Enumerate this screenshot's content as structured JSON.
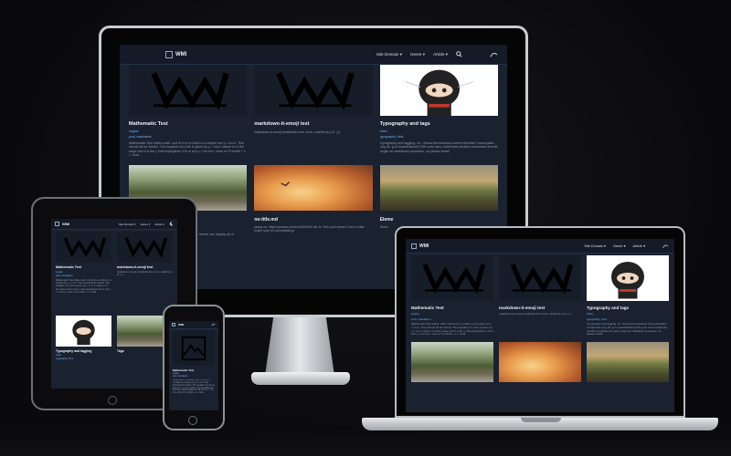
{
  "site": {
    "brand": "WMI",
    "nav": [
      "Site Domain ▾",
      "Genre ▾",
      "Article ▾"
    ],
    "search_icon": "search-icon",
    "theme_icon": "moon-icon"
  },
  "cards": [
    {
      "title": "Mathematic Test",
      "tag1": "engine",
      "tag2": "post, mandatum",
      "text": "Mathematic Test slides math: csd fa lri a m<Alles is a simple non y = mx b. This should all be inlined. The equation of y line is given by y = mx b. where m is the slope and b is the y intercept/planar 4 th m con y = mx b/x+ more m^2+nshift + x = -bcfa"
    },
    {
      "title": "markdown-it-emoji test",
      "tag1": "",
      "tag2": "",
      "text": "markdown-it-emoji templtedis from more: cadefin:js p D :) p"
    },
    {
      "title": "Typography and tags",
      "tag1": "index",
      "tag2": "typography, html",
      "text": "Typography and tagging: on: /Jesus-themes/lasco-theme-flowbite/ recuerpsfan-png-dir: jp it toward/stich/s/ jTitle post uses codehinas-mediam-markdown-it-turtle plugin as markdown processor, so please install"
    },
    {
      "title": "",
      "tag1": "",
      "tag2": "",
      "text": "Tag post tags with this post with WIll alt: br Tide. theme can display all of"
    },
    {
      "title": "no-title.md",
      "tag1": "",
      "tag2": "",
      "text": "plang on: https://picsum.photos/600/400 alt: br This post doesn't have a title. make sure it's accessible.jp"
    },
    {
      "title": "Eleme",
      "tag1": "",
      "tag2": "",
      "text": "Seem"
    }
  ],
  "tablet_cards": [
    {
      "title": "Mathematic Test",
      "tag1": "engine",
      "tag2": "post, mandatum"
    },
    {
      "title": "markdown-it-emoji test",
      "tag1": "",
      "tag2": ""
    },
    {
      "title": "Typography and tagging",
      "tag1": "index",
      "tag2": "typography, html"
    },
    {
      "title": "Tags",
      "tag1": "",
      "tag2": ""
    }
  ],
  "phone_card": {
    "title": "Mathematic Test",
    "tag1": "engine",
    "tag2": "post, mandatum"
  },
  "colors": {
    "bg": "#1a2230",
    "nav": "#141b27",
    "accent": "#6fb0ff",
    "frame": "#c9ccd2"
  }
}
